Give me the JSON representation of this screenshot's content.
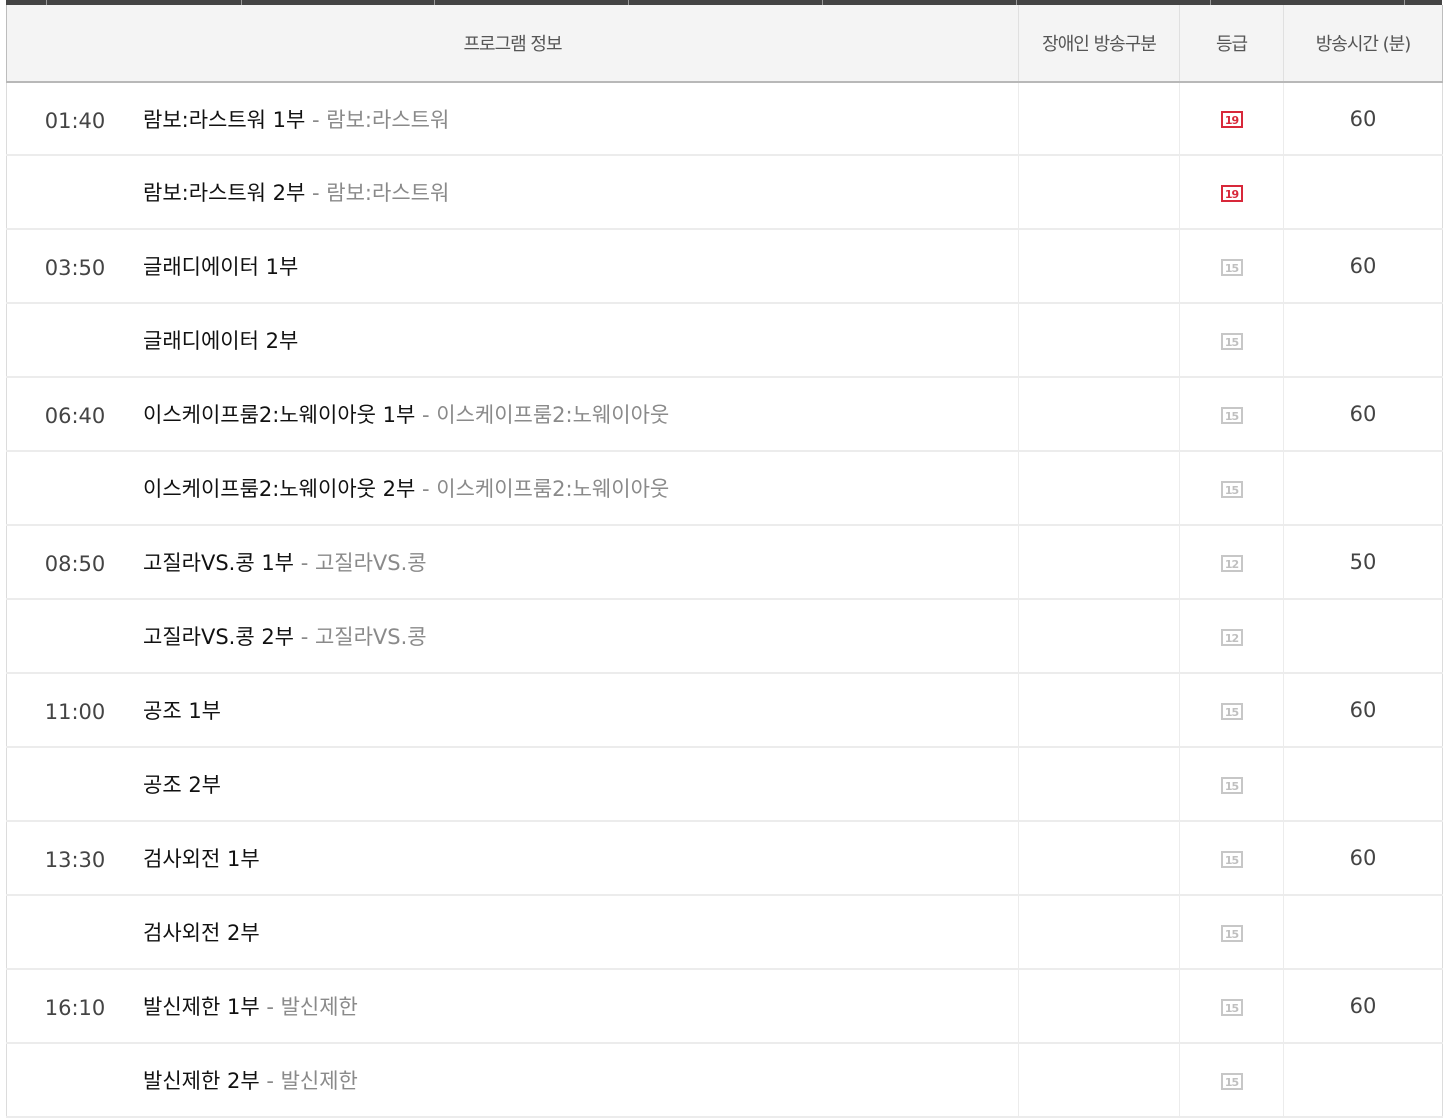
{
  "header": {
    "program_info": "프로그램 정보",
    "accessibility": "장애인 방송구분",
    "grade": "등급",
    "duration": "방송시간 (분)"
  },
  "colors": {
    "grade_19": "#d8283a",
    "grade_default": "#c7c7c7"
  },
  "rows": [
    {
      "time": "01:40",
      "title": "람보:라스트워 1부",
      "dash": " - ",
      "subtitle": "람보:라스트워",
      "grade": "19",
      "duration": "60"
    },
    {
      "time": "",
      "title": "람보:라스트워 2부",
      "dash": " - ",
      "subtitle": "람보:라스트워",
      "grade": "19",
      "duration": ""
    },
    {
      "time": "03:50",
      "title": "글래디에이터 1부",
      "dash": "",
      "subtitle": "",
      "grade": "15",
      "duration": "60"
    },
    {
      "time": "",
      "title": "글래디에이터 2부",
      "dash": "",
      "subtitle": "",
      "grade": "15",
      "duration": ""
    },
    {
      "time": "06:40",
      "title": "이스케이프룸2:노웨이아웃 1부",
      "dash": " - ",
      "subtitle": "이스케이프룸2:노웨이아웃",
      "grade": "15",
      "duration": "60"
    },
    {
      "time": "",
      "title": "이스케이프룸2:노웨이아웃 2부",
      "dash": " - ",
      "subtitle": "이스케이프룸2:노웨이아웃",
      "grade": "15",
      "duration": ""
    },
    {
      "time": "08:50",
      "title": "고질라VS.콩 1부",
      "dash": " - ",
      "subtitle": "고질라VS.콩",
      "grade": "12",
      "duration": "50"
    },
    {
      "time": "",
      "title": "고질라VS.콩 2부",
      "dash": " - ",
      "subtitle": "고질라VS.콩",
      "grade": "12",
      "duration": ""
    },
    {
      "time": "11:00",
      "title": "공조 1부",
      "dash": "",
      "subtitle": "",
      "grade": "15",
      "duration": "60"
    },
    {
      "time": "",
      "title": "공조 2부",
      "dash": "",
      "subtitle": "",
      "grade": "15",
      "duration": ""
    },
    {
      "time": "13:30",
      "title": "검사외전 1부",
      "dash": "",
      "subtitle": "",
      "grade": "15",
      "duration": "60"
    },
    {
      "time": "",
      "title": "검사외전 2부",
      "dash": "",
      "subtitle": "",
      "grade": "15",
      "duration": ""
    },
    {
      "time": "16:10",
      "title": "발신제한 1부",
      "dash": " - ",
      "subtitle": "발신제한",
      "grade": "15",
      "duration": "60"
    },
    {
      "time": "",
      "title": "발신제한 2부",
      "dash": " - ",
      "subtitle": "발신제한",
      "grade": "15",
      "duration": ""
    }
  ]
}
